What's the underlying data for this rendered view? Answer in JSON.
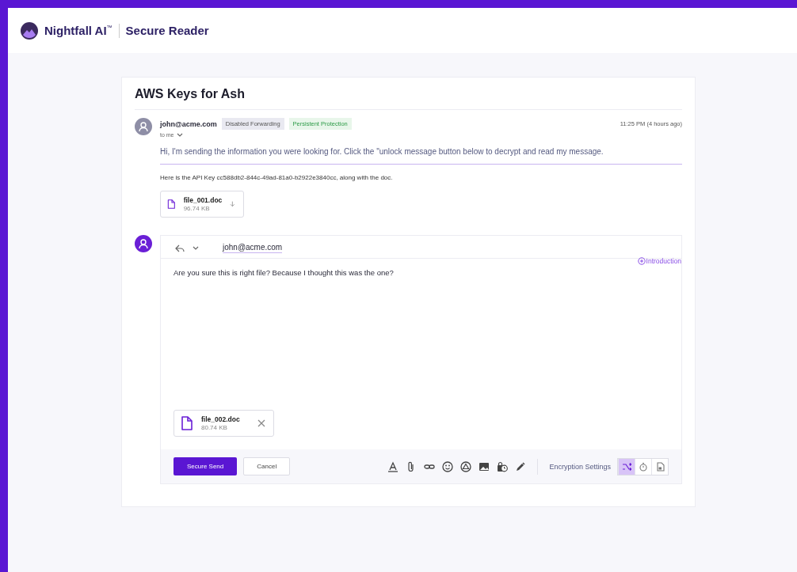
{
  "header": {
    "brand": "Nightfall AI",
    "trademark": "™",
    "product": "Secure Reader"
  },
  "message": {
    "subject": "AWS Keys for Ash",
    "sender": "john@acme.com",
    "tags": [
      {
        "label": "Disabled Forwarding",
        "color": "#e9e9f1"
      },
      {
        "label": "Persistent Protection",
        "color": "#e8f6ea"
      }
    ],
    "recipient": "to me",
    "time": "11:25 PM (4 hours ago)",
    "notice": "Hi, I'm sending the information you were looking for. Click the \"unlock message button below to decrypt and read my message.",
    "body": "Here is the API Key cc588db2-844c-49ad-81a0-b2922e3840cc, along with the doc.",
    "attachment": {
      "name": "file_001.doc",
      "size": "96.74 KB"
    }
  },
  "reply": {
    "to": "john@acme.com",
    "introduction": "Introduction",
    "text": "Are you sure this is right file? Because I thought this was the one?",
    "attachment": {
      "name": "file_002.doc",
      "size": "80.74 KB"
    },
    "send": "Secure Send",
    "cancel": "Cancel",
    "tools": [
      {
        "kind": "format"
      },
      {
        "kind": "attach"
      },
      {
        "kind": "link"
      },
      {
        "kind": "emoji"
      },
      {
        "kind": "drive"
      },
      {
        "kind": "image"
      },
      {
        "kind": "schedule"
      },
      {
        "kind": "pen"
      }
    ],
    "encryption_label": "Encryption Settings",
    "encryption_options": [
      {
        "kind": "shuffle",
        "selected": true
      },
      {
        "kind": "timer",
        "selected": false
      },
      {
        "kind": "lockdoc",
        "selected": false
      }
    ]
  }
}
